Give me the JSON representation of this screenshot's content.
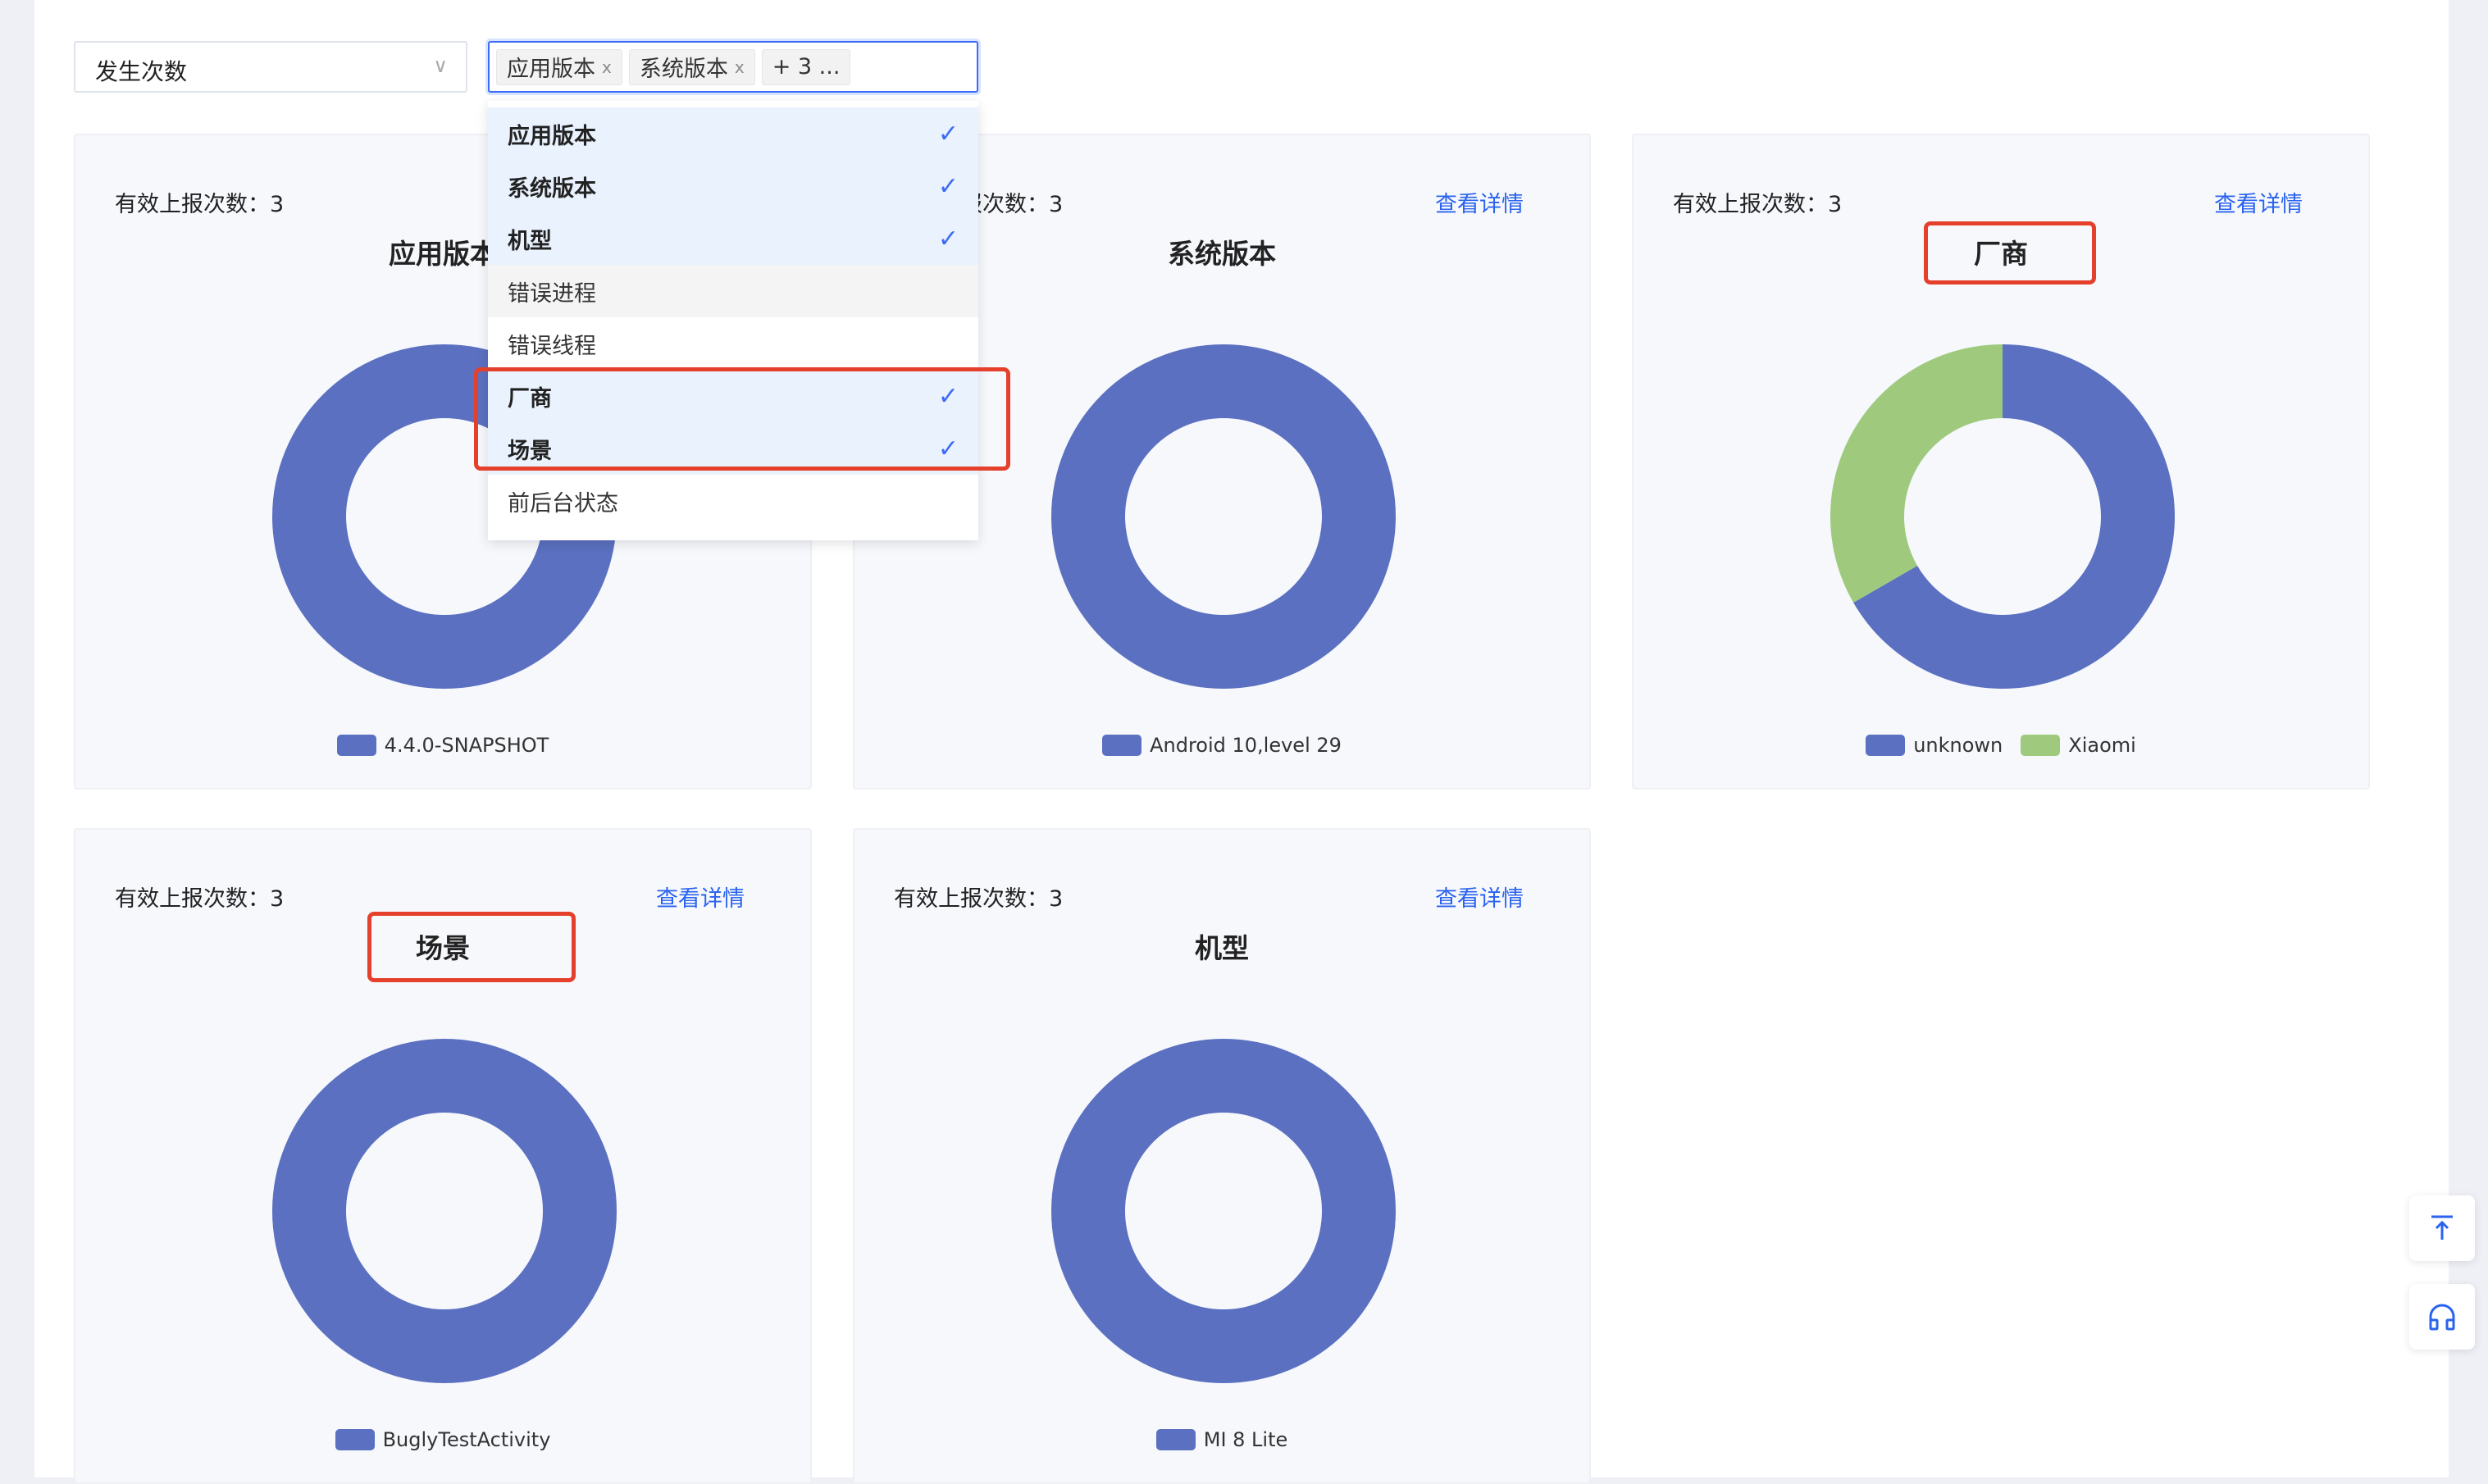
{
  "filters": {
    "metric": "发生次数",
    "dimensions_tags": [
      "应用版本",
      "系统版本"
    ],
    "more_tag": "+ 3 ..."
  },
  "dropdown": {
    "options": [
      {
        "label": "应用版本",
        "selected": true
      },
      {
        "label": "系统版本",
        "selected": true
      },
      {
        "label": "机型",
        "selected": true
      },
      {
        "label": "错误进程",
        "selected": false
      },
      {
        "label": "错误线程",
        "selected": false
      },
      {
        "label": "厂商",
        "selected": true
      },
      {
        "label": "场景",
        "selected": true
      },
      {
        "label": "前后台状态",
        "selected": false
      }
    ]
  },
  "card_count_label": "有效上报次数：3",
  "detail_link": "查看详情",
  "colors": {
    "blue": "#5b70c0",
    "green": "#9fca7e",
    "link": "#2a63f0",
    "highlight": "#e5402b"
  },
  "chart_data": [
    {
      "type": "pie",
      "title": "应用版本",
      "categories": [
        "4.4.0-SNAPSHOT"
      ],
      "values": [
        3
      ]
    },
    {
      "type": "pie",
      "title": "系统版本",
      "categories": [
        "Android 10,level 29"
      ],
      "values": [
        3
      ]
    },
    {
      "type": "pie",
      "title": "厂商",
      "categories": [
        "unknown",
        "Xiaomi"
      ],
      "values": [
        2,
        1
      ]
    },
    {
      "type": "pie",
      "title": "场景",
      "categories": [
        "BuglyTestActivity"
      ],
      "values": [
        3
      ]
    },
    {
      "type": "pie",
      "title": "机型",
      "categories": [
        "MI 8 Lite"
      ],
      "values": [
        3
      ]
    }
  ]
}
